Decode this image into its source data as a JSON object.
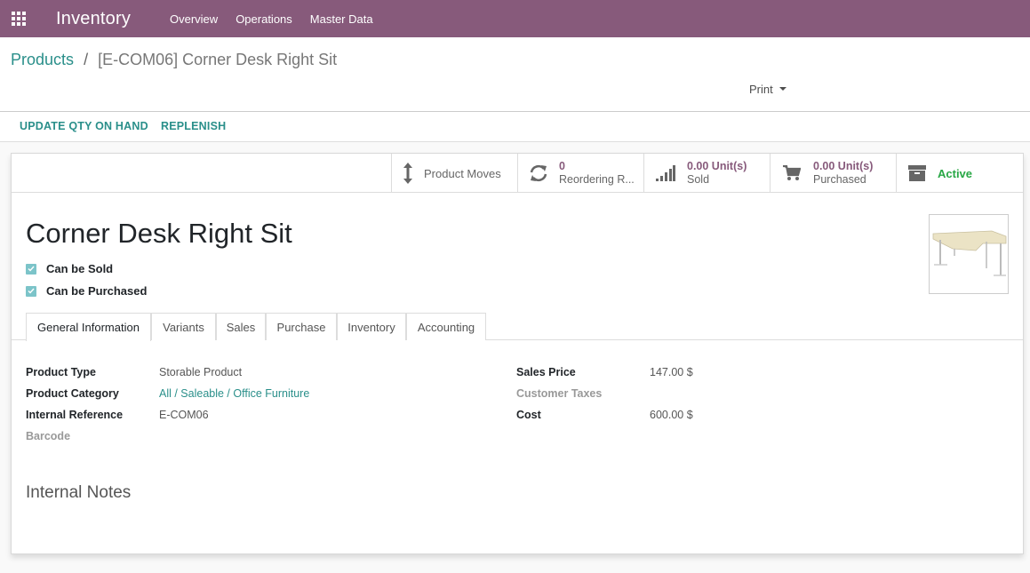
{
  "navbar": {
    "app_name": "Inventory",
    "menu": [
      "Overview",
      "Operations",
      "Master Data"
    ]
  },
  "breadcrumb": {
    "parent": "Products",
    "separator": "/",
    "current": "[E-COM06] Corner Desk Right Sit"
  },
  "control": {
    "print_label": "Print"
  },
  "statusbar": {
    "update_qty": "UPDATE QTY ON HAND",
    "replenish": "REPLENISH"
  },
  "smart_buttons": {
    "moves": {
      "label": "Product Moves",
      "icon": "arrows-v-icon"
    },
    "reordering": {
      "value": "0",
      "label": "Reordering R...",
      "icon": "refresh-icon"
    },
    "sold": {
      "value": "0.00 Unit(s)",
      "label": "Sold",
      "icon": "signal-icon"
    },
    "purchased": {
      "value": "0.00 Unit(s)",
      "label": "Purchased",
      "icon": "cart-icon"
    },
    "active": {
      "label": "Active",
      "icon": "archive-icon"
    }
  },
  "product": {
    "name": "Corner Desk Right Sit",
    "can_be_sold": "Can be Sold",
    "can_be_purchased": "Can be Purchased"
  },
  "tabs": [
    "General Information",
    "Variants",
    "Sales",
    "Purchase",
    "Inventory",
    "Accounting"
  ],
  "fields": {
    "product_type": {
      "label": "Product Type",
      "value": "Storable Product"
    },
    "product_category": {
      "label": "Product Category",
      "value": "All / Saleable / Office Furniture"
    },
    "internal_reference": {
      "label": "Internal Reference",
      "value": "E-COM06"
    },
    "barcode": {
      "label": "Barcode",
      "value": ""
    },
    "sales_price": {
      "label": "Sales Price",
      "value": "147.00 $"
    },
    "customer_taxes": {
      "label": "Customer Taxes",
      "value": ""
    },
    "cost": {
      "label": "Cost",
      "value": "600.00 $"
    }
  },
  "notes": {
    "title": "Internal Notes"
  },
  "colors": {
    "brand": "#875a7b",
    "link": "#2a8f8a",
    "active": "#28a745"
  }
}
